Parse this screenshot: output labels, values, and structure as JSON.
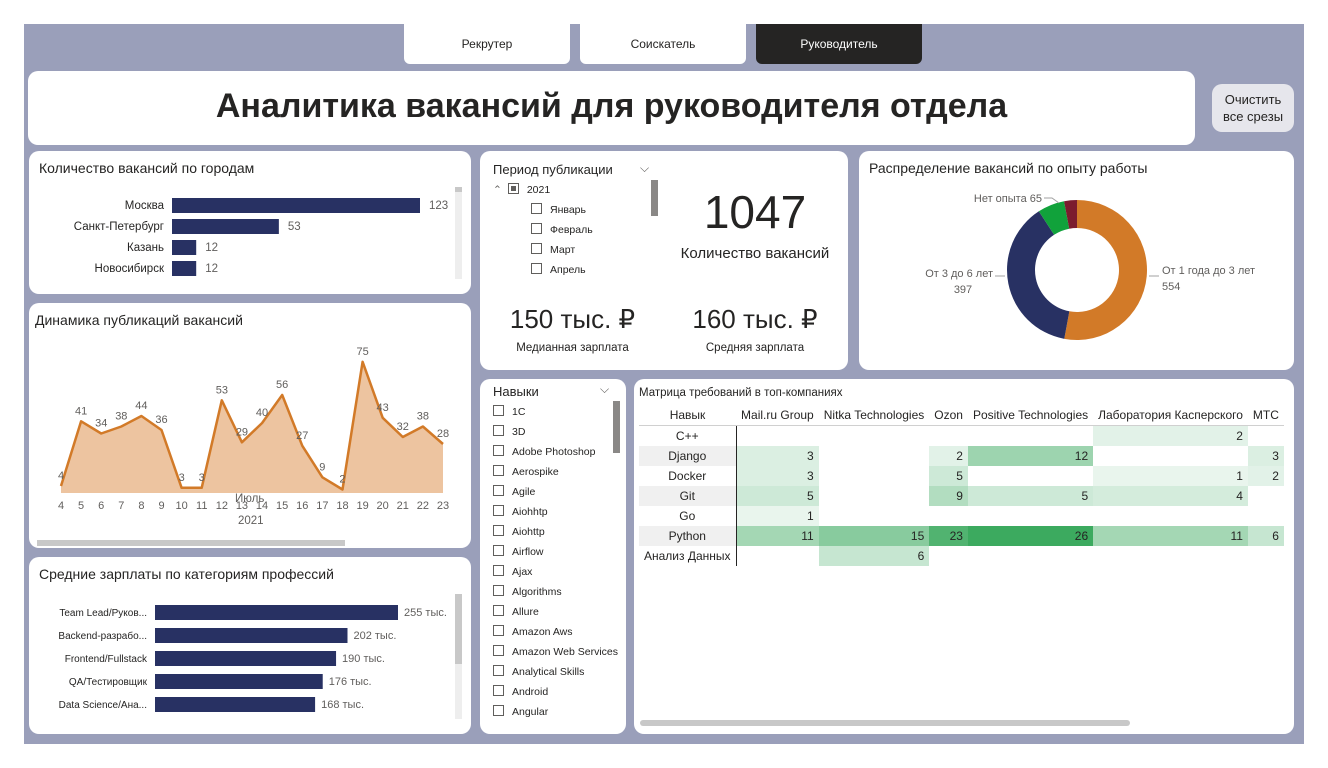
{
  "tabs": [
    {
      "label": "Рекрутер",
      "active": false
    },
    {
      "label": "Соискатель",
      "active": false
    },
    {
      "label": "Руководитель",
      "active": true
    }
  ],
  "header": {
    "title": "Аналитика вакансий для руководителя отдела",
    "clear_line1": "Очистить",
    "clear_line2": "все срезы"
  },
  "cities": {
    "title": "Количество вакансий по городам",
    "chart_data": {
      "type": "bar",
      "categories": [
        "Москва",
        "Санкт-Петербург",
        "Казань",
        "Новосибирск"
      ],
      "values": [
        123,
        53,
        12,
        12
      ],
      "color": "#283163"
    }
  },
  "period": {
    "title": "Период публикации",
    "year": "2021",
    "months": [
      "Январь",
      "Февраль",
      "Март",
      "Апрель"
    ]
  },
  "kpis": {
    "count_value": "1047",
    "count_label": "Количество вакансий",
    "median_value": "150 тыс. ₽",
    "median_label": "Медианная зарплата",
    "avg_value": "160 тыс. ₽",
    "avg_label": "Средняя зарплата"
  },
  "experience": {
    "title": "Распределение вакансий по опыту работы",
    "chart_data": {
      "type": "pie",
      "slices": [
        {
          "label": "От 1 года до 3 лет",
          "value": 554,
          "color": "#d27a28"
        },
        {
          "label": "От 3 до 6 лет",
          "value": 397,
          "color": "#283163"
        },
        {
          "label": "Нет опыта",
          "value": 65,
          "color": "#11a23b"
        },
        {
          "label": "",
          "value": 31,
          "color": "#7b1c2e"
        }
      ]
    }
  },
  "dynamics": {
    "title": "Динамика публикаций вакансий",
    "xlabel": "Июль",
    "year": "2021",
    "chart_data": {
      "type": "area",
      "x": [
        4,
        5,
        6,
        7,
        8,
        9,
        10,
        11,
        12,
        13,
        14,
        15,
        16,
        17,
        18,
        19,
        20,
        21,
        22,
        23
      ],
      "values": [
        4,
        41,
        34,
        38,
        44,
        36,
        3,
        3,
        53,
        29,
        40,
        56,
        27,
        9,
        2,
        75,
        43,
        32,
        38,
        28
      ],
      "ylim": [
        0,
        80
      ],
      "line_color": "#d27a28",
      "fill_color": "#edc4a0"
    }
  },
  "salaries": {
    "title": "Средние зарплаты по категориям профессий",
    "chart_data": {
      "type": "bar",
      "categories": [
        "Team Lead/Руков...",
        "Backend-разрабо...",
        "Frontend/Fullstack",
        "QA/Тестировщик",
        "Data Science/Ана..."
      ],
      "values": [
        255,
        202,
        190,
        176,
        168
      ],
      "value_labels": [
        "255 тыс.",
        "202 тыс.",
        "190 тыс.",
        "176 тыс.",
        "168 тыс."
      ],
      "color": "#283163"
    }
  },
  "skills": {
    "title": "Навыки",
    "items": [
      "1С",
      "3D",
      "Adobe Photoshop",
      "Aerospike",
      "Agile",
      "Aiohhtp",
      "Aiohttp",
      "Airflow",
      "Ajax",
      "Algorithms",
      "Allure",
      "Amazon Aws",
      "Amazon Web Services",
      "Analytical Skills",
      "Android",
      "Angular"
    ]
  },
  "matrix": {
    "title": "Матрица требований в топ-компаниях",
    "corner": "Навык",
    "columns": [
      "Mail.ru Group",
      "Nitka Technologies",
      "Ozon",
      "Positive Technologies",
      "Лаборатория Касперского",
      "МТС"
    ],
    "rows": [
      {
        "skill": "C++",
        "values": [
          "",
          "",
          "",
          "",
          "2",
          ""
        ]
      },
      {
        "skill": "Django",
        "values": [
          "3",
          "",
          "2",
          "12",
          "",
          "3"
        ]
      },
      {
        "skill": "Docker",
        "values": [
          "3",
          "",
          "5",
          "",
          "1",
          "2"
        ]
      },
      {
        "skill": "Git",
        "values": [
          "5",
          "",
          "9",
          "5",
          "4",
          ""
        ]
      },
      {
        "skill": "Go",
        "values": [
          "1",
          "",
          "",
          "",
          "",
          ""
        ]
      },
      {
        "skill": "Python",
        "values": [
          "11",
          "15",
          "23",
          "26",
          "11",
          "6"
        ]
      },
      {
        "skill": "Анализ Данных",
        "values": [
          "",
          "6",
          "",
          "",
          "",
          ""
        ]
      }
    ]
  }
}
